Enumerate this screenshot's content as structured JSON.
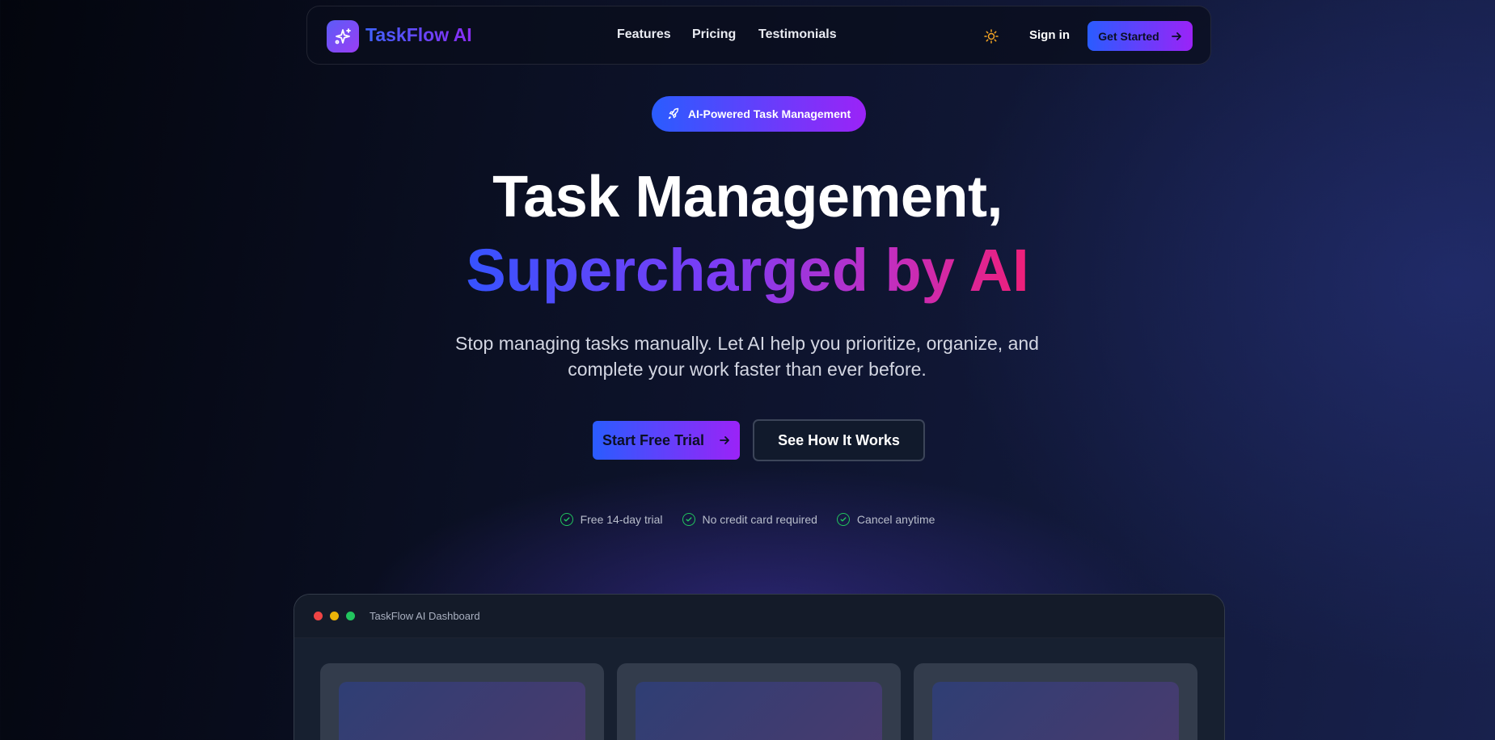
{
  "nav": {
    "brand": "TaskFlow AI",
    "links": [
      "Features",
      "Pricing",
      "Testimonials"
    ],
    "theme_icon": "sun-icon",
    "signin": "Sign in",
    "get_started": "Get Started"
  },
  "hero": {
    "badge": "AI-Powered Task Management",
    "headline_line1": "Task Management,",
    "headline_line2": "Supercharged by AI",
    "subtitle": "Stop managing tasks manually. Let AI help you prioritize, organize, and complete your work faster than ever before.",
    "cta_primary": "Start Free Trial",
    "cta_secondary": "See How It Works",
    "perks": [
      "Free 14-day trial",
      "No credit card required",
      "Cancel anytime"
    ]
  },
  "dashboard": {
    "title": "TaskFlow AI Dashboard",
    "window_dots": [
      "#ef4444",
      "#eab308",
      "#22c55e"
    ]
  },
  "colors": {
    "accent_start": "#2a5cff",
    "accent_end": "#9b23f7",
    "check": "#22c55e"
  }
}
